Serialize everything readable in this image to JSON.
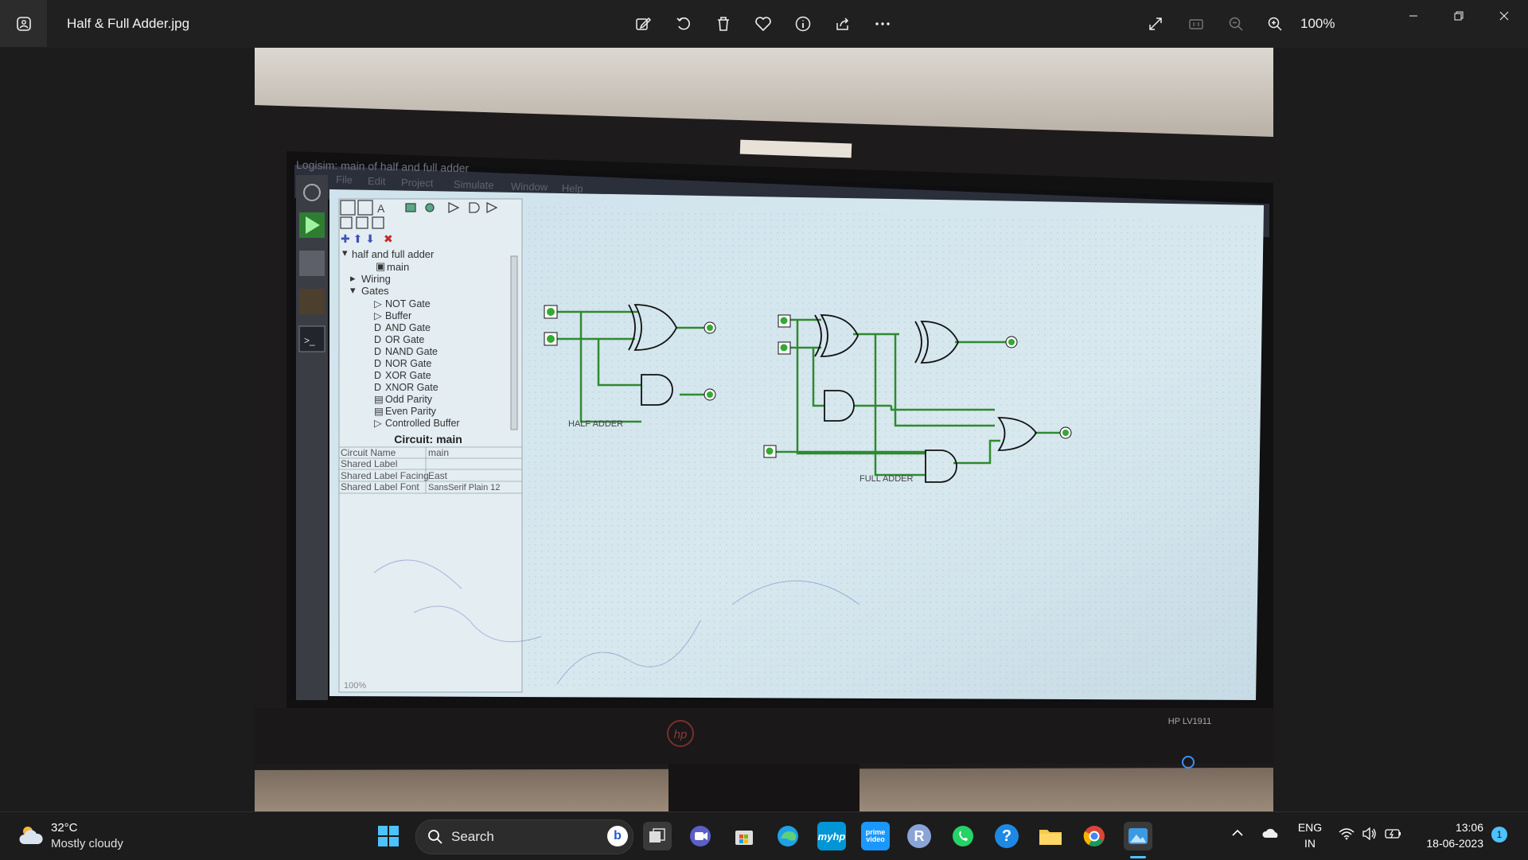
{
  "window": {
    "file_name": "Half & Full Adder.jpg",
    "zoom_level": "100%"
  },
  "toolbar_icons": [
    "edit-image-icon",
    "rotate-icon",
    "delete-icon",
    "favorite-icon",
    "info-icon",
    "share-icon",
    "more-icon"
  ],
  "photo": {
    "app_title": "Logisim: main of half and full adder",
    "menu": [
      "File",
      "Edit",
      "Project",
      "Simulate",
      "Window",
      "Help"
    ],
    "tree": {
      "project": "half and full adder",
      "circuit": "main",
      "folders": [
        "Wiring",
        "Gates"
      ],
      "gates": [
        "NOT Gate",
        "Buffer",
        "AND Gate",
        "OR Gate",
        "NAND Gate",
        "NOR Gate",
        "XOR Gate",
        "XNOR Gate",
        "Odd Parity",
        "Even Parity",
        "Controlled Buffer"
      ]
    },
    "attributes": {
      "heading": "Circuit: main",
      "rows": [
        {
          "name": "Circuit Name",
          "value": "main"
        },
        {
          "name": "Shared Label",
          "value": ""
        },
        {
          "name": "Shared Label Facing",
          "value": "East"
        },
        {
          "name": "Shared Label Font",
          "value": "SansSerif Plain 12"
        }
      ]
    },
    "zoom_status": "100%",
    "canvas_labels": {
      "half_adder": "HALF ADDER",
      "full_adder": "FULL ADDER"
    },
    "monitor_model": "HP LV1911",
    "brand": "hp"
  },
  "taskbar": {
    "weather_temp": "32°C",
    "weather_desc": "Mostly cloudy",
    "search_label": "Search",
    "apps": [
      "task-view-icon",
      "teams-icon",
      "store-icon",
      "edge-icon",
      "myhp-icon",
      "prime-video-icon",
      "r-app-icon",
      "whatsapp-icon",
      "help-icon",
      "file-explorer-icon",
      "chrome-icon",
      "photos-icon"
    ],
    "lang_top": "ENG",
    "lang_bottom": "IN",
    "time": "13:06",
    "date": "18-06-2023",
    "notification_count": "1"
  }
}
